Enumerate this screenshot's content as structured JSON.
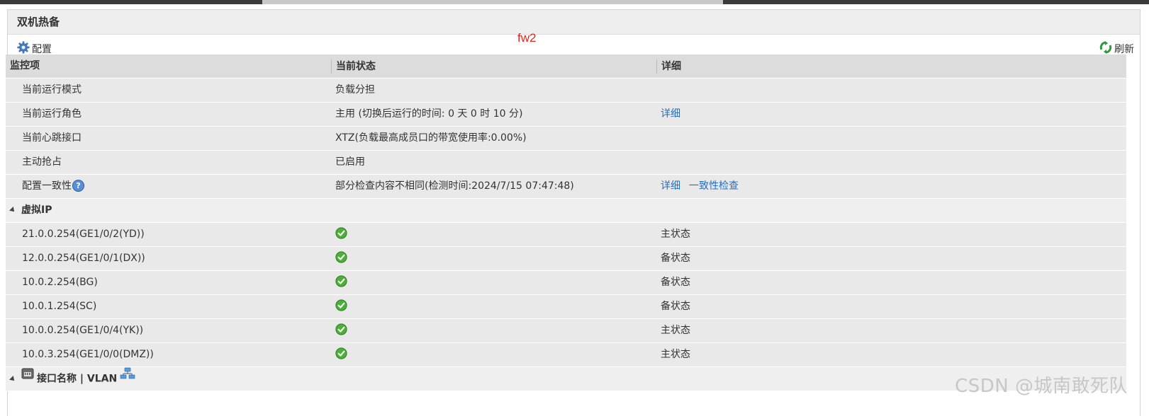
{
  "panel": {
    "title": "双机热备"
  },
  "annotation": {
    "label": "fw2"
  },
  "toolbar": {
    "config_label": "配置",
    "refresh_label": "刷新"
  },
  "table": {
    "headers": [
      "监控项",
      "当前状态",
      "详细"
    ],
    "rows": [
      {
        "item": "当前运行模式",
        "status": "负载分担",
        "detail": ""
      },
      {
        "item": "当前运行角色",
        "status": "主用 (切换后运行的时间: 0 天 0 时 10 分)",
        "detail": "详细"
      },
      {
        "item": "当前心跳接口",
        "status": "XTZ(负载最高成员口的带宽使用率:0.00%)",
        "detail": ""
      },
      {
        "item": "主动抢占",
        "status": "已启用",
        "detail": ""
      },
      {
        "item": "配置一致性",
        "help": "?",
        "status": "部分检查内容不相同(检测时间:2024/7/15 07:47:48)",
        "detail": "详细",
        "detail2": "一致性检查"
      }
    ],
    "virtual_ip_group": {
      "title": "虚拟IP",
      "rows": [
        {
          "item": "21.0.0.254(GE1/0/2(YD))",
          "status_icon": "check-circle-icon",
          "detail": "主状态"
        },
        {
          "item": "12.0.0.254(GE1/0/1(DX))",
          "status_icon": "check-circle-icon",
          "detail": "备状态"
        },
        {
          "item": "10.0.2.254(BG)",
          "status_icon": "check-circle-icon",
          "detail": "备状态"
        },
        {
          "item": "10.0.1.254(SC)",
          "status_icon": "check-circle-icon",
          "detail": "备状态"
        },
        {
          "item": "10.0.0.254(GE1/0/4(YK))",
          "status_icon": "check-circle-icon",
          "detail": "主状态"
        },
        {
          "item": "10.0.3.254(GE1/0/0(DMZ))",
          "status_icon": "check-circle-icon",
          "detail": "主状态"
        }
      ]
    },
    "interface_group": {
      "title": "接口名称 | VLAN"
    }
  },
  "watermark": "CSDN @城南敢死队",
  "colors": {
    "link": "#1f6fc9",
    "annotation": "#e0261e",
    "ok": "#4caf3a"
  }
}
